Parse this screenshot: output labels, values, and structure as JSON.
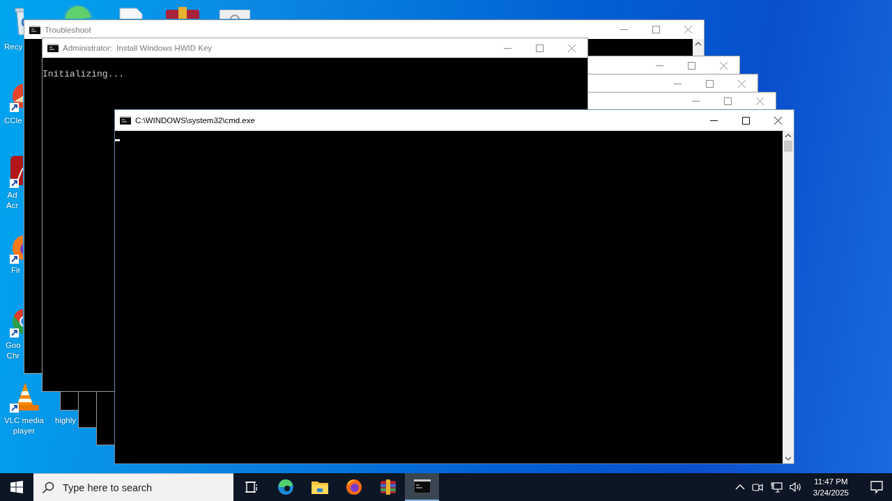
{
  "desktop": {
    "icons": [
      {
        "label_lines": [
          "Recy"
        ]
      },
      {
        "label_lines": [
          "CCle"
        ]
      },
      {
        "label_lines": [
          "Ad",
          "Acr"
        ]
      },
      {
        "label_lines": [
          "Fir"
        ]
      },
      {
        "label_lines": [
          "Goo",
          "Chr"
        ]
      },
      {
        "label_lines": [
          "VLC media",
          "player"
        ]
      },
      {
        "label_lines": [
          "highly"
        ]
      }
    ]
  },
  "windows": [
    {
      "title": "Troubleshoot",
      "active": false
    },
    {
      "active": false
    },
    {
      "active": false
    },
    {
      "active": false
    },
    {
      "title": "Administrator:  Install Windows HWID Key",
      "active": false,
      "console_text": "Initializing..."
    },
    {
      "title": "C:\\WINDOWS\\system32\\cmd.exe",
      "active": true,
      "cursor": true
    }
  ],
  "taskbar": {
    "search": {
      "placeholder": "Type here to search"
    },
    "apps": [
      {
        "selected": false
      },
      {
        "selected": false
      },
      {
        "selected": false
      },
      {
        "selected": false
      },
      {
        "selected": false
      },
      {
        "selected": true
      }
    ],
    "clock": {
      "time": "11:47 PM",
      "date": "3/24/2025"
    }
  }
}
